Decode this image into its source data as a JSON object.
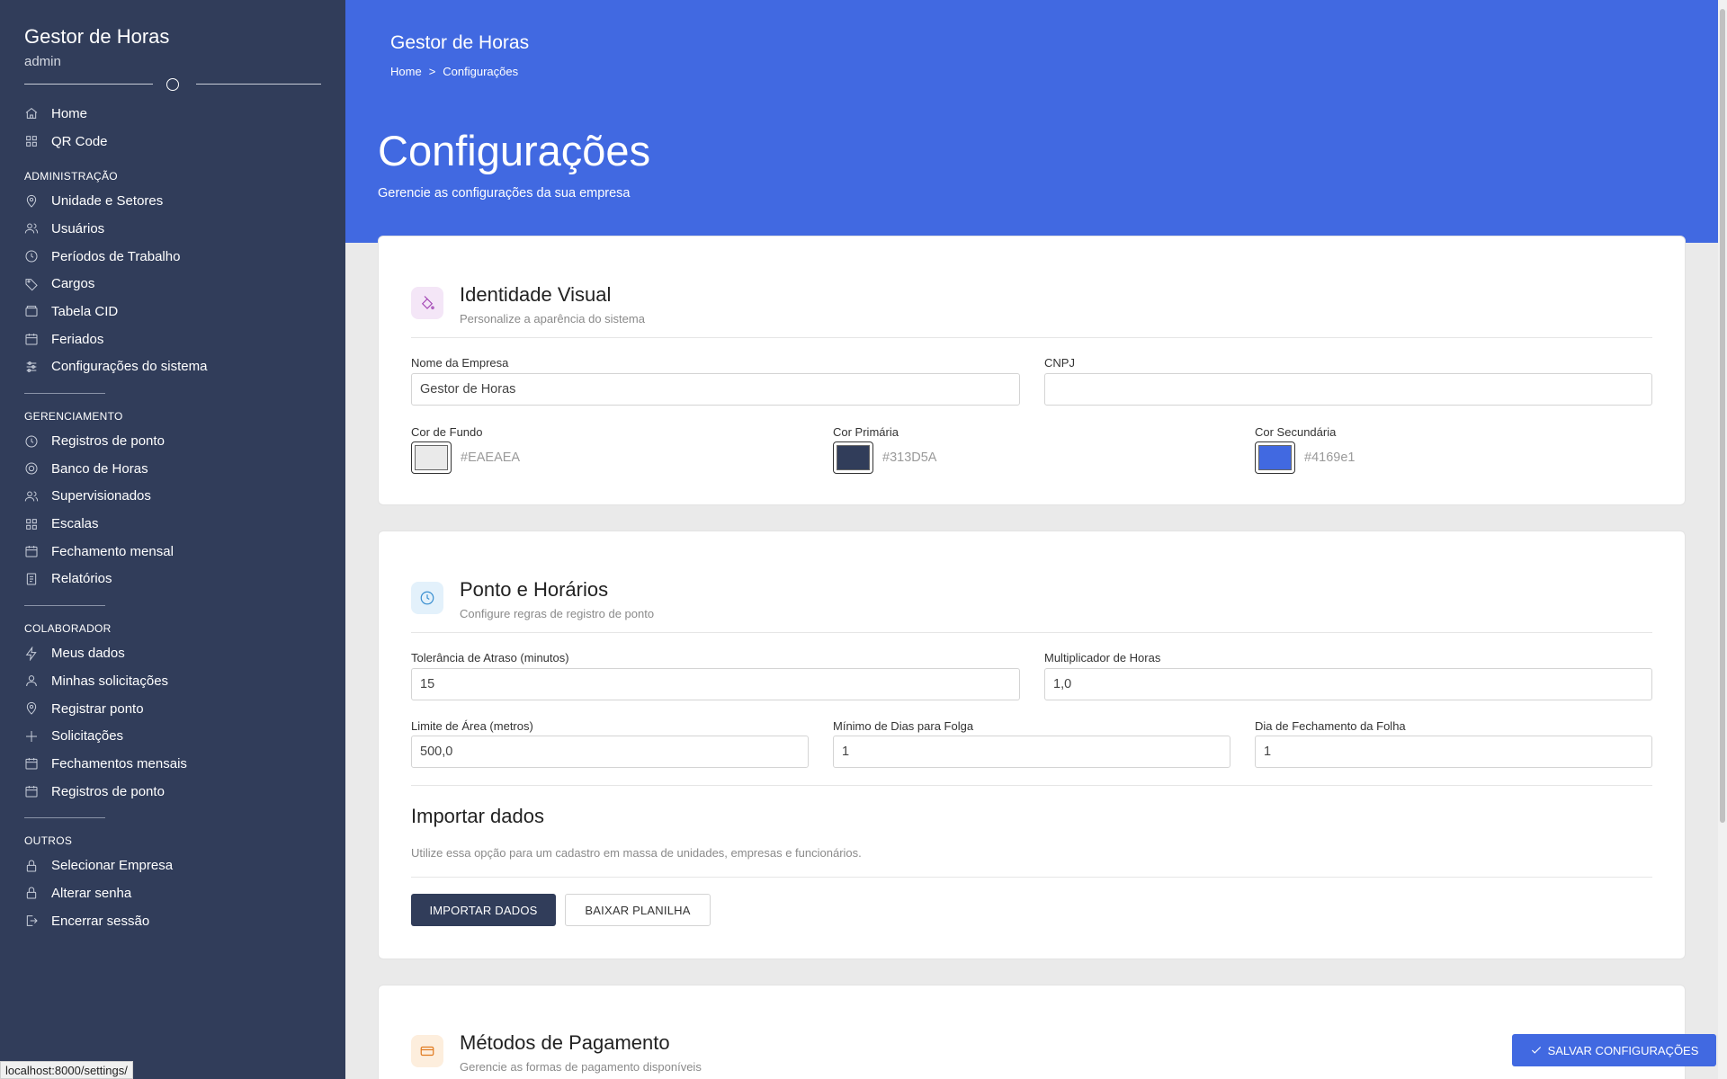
{
  "sidebar": {
    "brand_title": "Gestor de Horas",
    "brand_user": "admin",
    "top_items": [
      {
        "label": "Home",
        "icon": "home-icon"
      },
      {
        "label": "QR Code",
        "icon": "grid-icon"
      }
    ],
    "sections": [
      {
        "title": "ADMINISTRAÇÃO",
        "items": [
          {
            "label": "Unidade e Setores",
            "icon": "map-pin-icon"
          },
          {
            "label": "Usuários",
            "icon": "users-icon"
          },
          {
            "label": "Períodos de Trabalho",
            "icon": "clock-icon"
          },
          {
            "label": "Cargos",
            "icon": "tag-icon"
          },
          {
            "label": "Tabela CID",
            "icon": "folder-icon"
          },
          {
            "label": "Feriados",
            "icon": "calendar-icon"
          },
          {
            "label": "Configurações do sistema",
            "icon": "sliders-icon"
          }
        ]
      },
      {
        "title": "GERENCIAMENTO",
        "items": [
          {
            "label": "Registros de ponto",
            "icon": "clock-icon"
          },
          {
            "label": "Banco de Horas",
            "icon": "target-icon"
          },
          {
            "label": "Supervisionados",
            "icon": "users-icon"
          },
          {
            "label": "Escalas",
            "icon": "grid-icon"
          },
          {
            "label": "Fechamento mensal",
            "icon": "calendar-icon"
          },
          {
            "label": "Relatórios",
            "icon": "document-icon"
          }
        ]
      },
      {
        "title": "COLABORADOR",
        "items": [
          {
            "label": "Meus dados",
            "icon": "bolt-icon"
          },
          {
            "label": "Minhas solicitações",
            "icon": "user-icon"
          },
          {
            "label": "Registrar ponto",
            "icon": "map-pin-icon"
          },
          {
            "label": "Solicitações",
            "icon": "plus-icon"
          },
          {
            "label": "Fechamentos mensais",
            "icon": "calendar-icon"
          },
          {
            "label": "Registros de ponto",
            "icon": "calendar-icon"
          }
        ]
      },
      {
        "title": "OUTROS",
        "items": [
          {
            "label": "Selecionar Empresa",
            "icon": "lock-icon"
          },
          {
            "label": "Alterar senha",
            "icon": "lock-icon"
          },
          {
            "label": "Encerrar sessão",
            "icon": "logout-icon"
          }
        ]
      }
    ]
  },
  "status_url": "localhost:8000/settings/",
  "header": {
    "app_title": "Gestor de Horas",
    "breadcrumb": [
      "Home",
      ">",
      "Configurações"
    ],
    "page_title": "Configurações",
    "page_subtitle": "Gerencie as configurações da sua empresa"
  },
  "identity": {
    "title": "Identidade Visual",
    "desc": "Personalize a aparência do sistema",
    "company_label": "Nome da Empresa",
    "company_value": "Gestor de Horas",
    "cnpj_label": "CNPJ",
    "cnpj_value": "",
    "bg_label": "Cor de Fundo",
    "bg_hex": "#EAEAEA",
    "primary_label": "Cor Primária",
    "primary_hex": "#313D5A",
    "secondary_label": "Cor Secundária",
    "secondary_hex": "#4169e1"
  },
  "ponto": {
    "title": "Ponto e Horários",
    "desc": "Configure regras de registro de ponto",
    "tolerance_label": "Tolerância de Atraso (minutos)",
    "tolerance_value": "15",
    "multiplier_label": "Multiplicador de Horas",
    "multiplier_value": "1,0",
    "area_label": "Limite de Área (metros)",
    "area_value": "500,0",
    "min_days_label": "Mínimo de Dias para Folga",
    "min_days_value": "1",
    "closing_day_label": "Dia de Fechamento da Folha",
    "closing_day_value": "1",
    "import_title": "Importar dados",
    "import_desc": "Utilize essa opção para um cadastro em massa de unidades, empresas e funcionários.",
    "import_button": "IMPORTAR DADOS",
    "download_button": "BAIXAR PLANILHA"
  },
  "payment": {
    "title": "Métodos de Pagamento",
    "desc": "Gerencie as formas de pagamento disponíveis"
  },
  "save_button": "SALVAR CONFIGURAÇÕES",
  "colors": {
    "sidebar": "#313D5A",
    "accent": "#4169E1",
    "background": "#EAEAEA"
  }
}
